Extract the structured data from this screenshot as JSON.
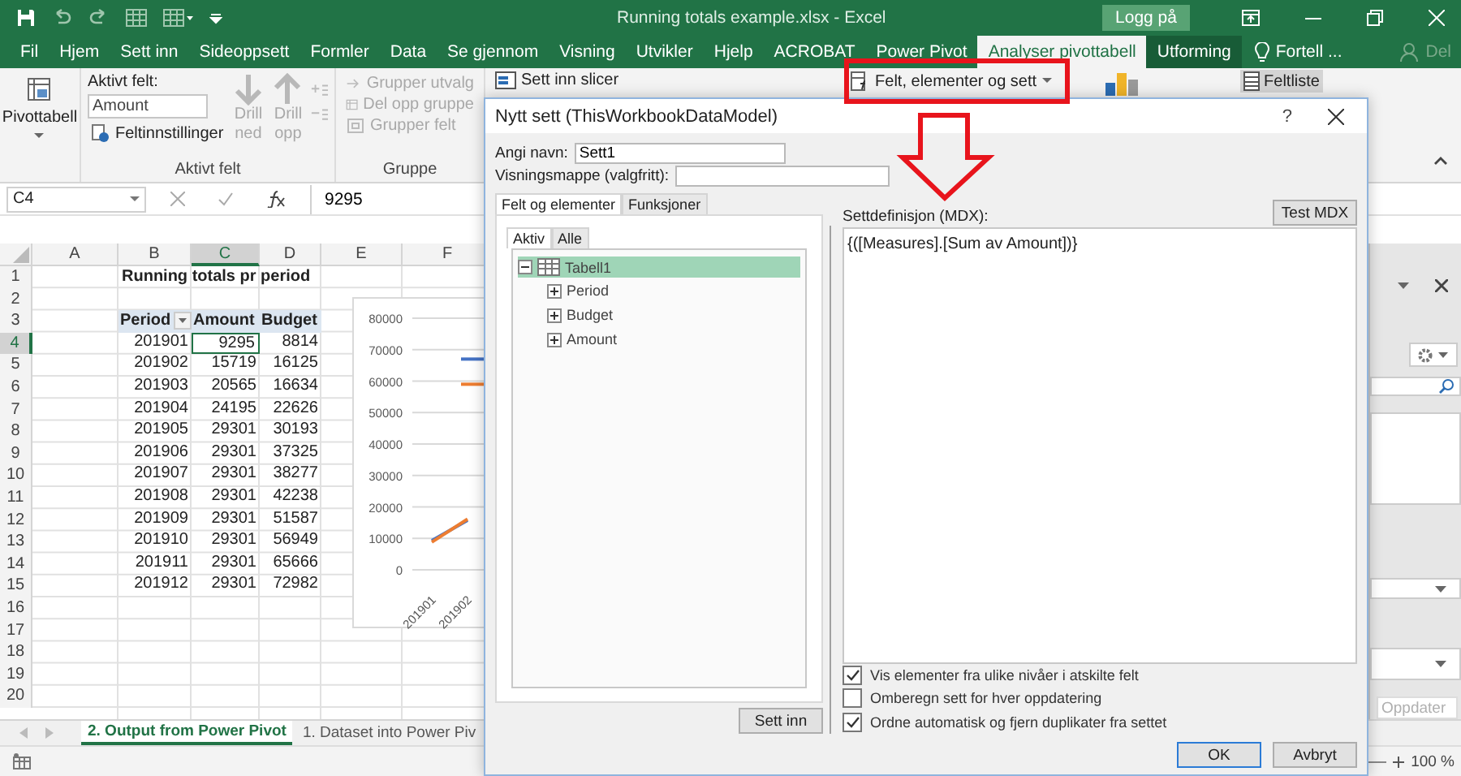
{
  "window": {
    "title": "Running totals example.xlsx  -  Excel",
    "sign_in": "Logg på"
  },
  "ribbon_tabs": [
    {
      "label": "Fil",
      "kind": "normal",
      "selected": false
    },
    {
      "label": "Hjem",
      "kind": "normal",
      "selected": false
    },
    {
      "label": "Sett inn",
      "kind": "normal",
      "selected": false
    },
    {
      "label": "Sideoppsett",
      "kind": "normal",
      "selected": false
    },
    {
      "label": "Formler",
      "kind": "normal",
      "selected": false
    },
    {
      "label": "Data",
      "kind": "normal",
      "selected": false
    },
    {
      "label": "Se gjennom",
      "kind": "normal",
      "selected": false
    },
    {
      "label": "Visning",
      "kind": "normal",
      "selected": false
    },
    {
      "label": "Utvikler",
      "kind": "normal",
      "selected": false
    },
    {
      "label": "Hjelp",
      "kind": "normal",
      "selected": false
    },
    {
      "label": "ACROBAT",
      "kind": "normal",
      "selected": false
    },
    {
      "label": "Power Pivot",
      "kind": "normal",
      "selected": false
    },
    {
      "label": "Analyser pivottabell",
      "kind": "contextual",
      "selected": true
    },
    {
      "label": "Utforming",
      "kind": "contextual",
      "selected": false
    }
  ],
  "tell_me": "Fortell ...",
  "share": "Del",
  "ribbon": {
    "pivot_table": "Pivottabell",
    "active_field_caption": "Aktivt felt:",
    "active_field_value": "Amount",
    "field_settings": "Feltinnstillinger",
    "drill": [
      {
        "label": "Drill ned",
        "kind": "down",
        "disabled": true
      },
      {
        "label": "Drill opp",
        "kind": "up",
        "disabled": true
      }
    ],
    "group_items": [
      {
        "label": "Grupper utvalg",
        "kind": "group",
        "disabled": true
      },
      {
        "label": "Del opp gruppe",
        "kind": "ungroup",
        "disabled": true
      },
      {
        "label": "Grupper felt",
        "kind": "field",
        "disabled": true
      }
    ],
    "group_labels": [
      "Aktivt felt",
      "Gruppe"
    ],
    "insert_slicer": "Sett inn slicer",
    "fields_items_sets": "Felt, elementer og sett",
    "field_list": {
      "label": "Feltliste",
      "selected": true
    }
  },
  "formula_bar": {
    "name_box": "C4",
    "value": "9295"
  },
  "sheet": {
    "columns": [
      {
        "label": "A",
        "selected": false
      },
      {
        "label": "B",
        "selected": false
      },
      {
        "label": "C",
        "selected": true
      },
      {
        "label": "D",
        "selected": false
      },
      {
        "label": "E",
        "selected": false
      },
      {
        "label": "F",
        "selected": false
      }
    ],
    "rows": [
      {
        "number": "1",
        "kind": "title",
        "selected": false,
        "values": [
          "Running totals pr period"
        ]
      },
      {
        "number": "2",
        "kind": "empty",
        "selected": false
      },
      {
        "number": "3",
        "kind": "header",
        "selected": false,
        "values": [
          "Period",
          "Amount",
          "Budget"
        ]
      },
      {
        "number": "4",
        "kind": "data",
        "selected": true,
        "values": [
          "201901",
          "9295",
          "8814"
        ]
      },
      {
        "number": "5",
        "kind": "data",
        "selected": false,
        "values": [
          "201902",
          "15719",
          "16125"
        ]
      },
      {
        "number": "6",
        "kind": "data",
        "selected": false,
        "values": [
          "201903",
          "20565",
          "16634"
        ]
      },
      {
        "number": "7",
        "kind": "data",
        "selected": false,
        "values": [
          "201904",
          "24195",
          "22626"
        ]
      },
      {
        "number": "8",
        "kind": "data",
        "selected": false,
        "values": [
          "201905",
          "29301",
          "30193"
        ]
      },
      {
        "number": "9",
        "kind": "data",
        "selected": false,
        "values": [
          "201906",
          "29301",
          "37325"
        ]
      },
      {
        "number": "10",
        "kind": "data",
        "selected": false,
        "values": [
          "201907",
          "29301",
          "38277"
        ]
      },
      {
        "number": "11",
        "kind": "data",
        "selected": false,
        "values": [
          "201908",
          "29301",
          "42238"
        ]
      },
      {
        "number": "12",
        "kind": "data",
        "selected": false,
        "values": [
          "201909",
          "29301",
          "51587"
        ]
      },
      {
        "number": "13",
        "kind": "data",
        "selected": false,
        "values": [
          "201910",
          "29301",
          "56949"
        ]
      },
      {
        "number": "14",
        "kind": "data",
        "selected": false,
        "values": [
          "201911",
          "29301",
          "65666"
        ]
      },
      {
        "number": "15",
        "kind": "data",
        "selected": false,
        "values": [
          "201912",
          "29301",
          "72982"
        ]
      },
      {
        "number": "16",
        "kind": "empty",
        "selected": false
      },
      {
        "number": "17",
        "kind": "empty",
        "selected": false
      },
      {
        "number": "18",
        "kind": "empty",
        "selected": false
      },
      {
        "number": "19",
        "kind": "empty",
        "selected": false
      },
      {
        "number": "20",
        "kind": "empty",
        "selected": false
      }
    ],
    "chart": {
      "chart_data": {
        "type": "line",
        "grid": true,
        "categories": [
          "201901",
          "201902"
        ],
        "ylim": [
          0,
          80000
        ],
        "yticks": [
          0,
          10000,
          20000,
          30000,
          40000,
          50000,
          60000,
          70000,
          80000
        ],
        "series": [
          {
            "color": "#4472c4",
            "values": [
              9295,
              15719
            ]
          },
          {
            "color": "#ed7d31",
            "values": [
              8814,
              16125
            ]
          }
        ]
      }
    }
  },
  "sheet_tabs": [
    {
      "label": "2. Output from Power Pivot",
      "selected": true
    },
    {
      "label": "1. Dataset into Power Piv",
      "selected": false
    }
  ],
  "field_pane": {
    "refresh": {
      "label": "Oppdater",
      "disabled": true
    }
  },
  "status_bar": {
    "zoom": "100 %"
  },
  "dialog": {
    "title": "Nytt sett (ThisWorkbookDataModel)",
    "help": "?",
    "name_label": "Angi navn:",
    "name_value": "Sett1",
    "folder_label": "Visningsmappe (valgfritt):",
    "tabs": [
      {
        "label": "Felt og elementer",
        "selected": true
      },
      {
        "label": "Funksjoner",
        "selected": false
      }
    ],
    "inner_tabs": [
      {
        "label": "Aktiv",
        "selected": true
      },
      {
        "label": "Alle",
        "selected": false
      }
    ],
    "tree": [
      {
        "label": "Tabell1",
        "expanded": true,
        "selected": true,
        "children": [
          {
            "label": "Period",
            "expanded": false,
            "selected": false
          },
          {
            "label": "Budget",
            "expanded": false,
            "selected": false
          },
          {
            "label": "Amount",
            "expanded": false,
            "selected": false
          }
        ]
      }
    ],
    "insert_button": "Sett inn",
    "mdx_label": "Settdefinisjon (MDX):",
    "test_button": "Test MDX",
    "mdx_value": "{([Measures].[Sum av Amount])}",
    "options": [
      {
        "label": "Vis elementer fra ulike nivåer i atskilte felt",
        "checked": true
      },
      {
        "label": "Omberegn sett for hver oppdatering",
        "checked": false
      },
      {
        "label": "Ordne automatisk og fjern duplikater fra settet",
        "checked": true
      }
    ],
    "ok": "OK",
    "cancel": "Avbryt"
  }
}
